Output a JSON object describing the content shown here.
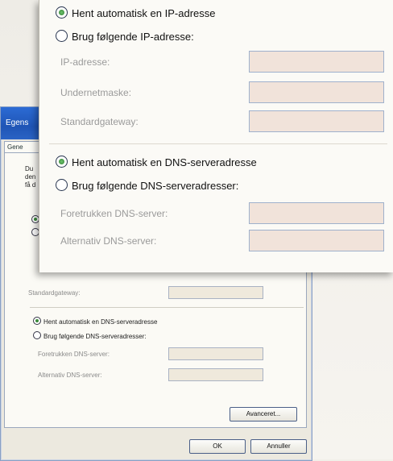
{
  "back_dialog": {
    "title": "Egens",
    "tab": "Gene",
    "intro": "Du den få d",
    "label_standard_gateway": "Standardgateway:",
    "radio_auto_dns": "Hent automatisk en DNS-serveradresse",
    "radio_manual_dns": "Brug følgende DNS-serveradresser:",
    "label_preferred_dns": "Foretrukken DNS-server:",
    "label_alternate_dns": "Alternativ DNS-server:",
    "advanced_button": "Avanceret...",
    "ok_button": "OK",
    "cancel_button": "Annuller"
  },
  "front_dialog": {
    "radio_auto_ip": "Hent automatisk en IP-adresse",
    "radio_manual_ip": "Brug følgende IP-adresse:",
    "label_ip": "IP-adresse:",
    "label_subnet": "Undernetmaske:",
    "label_gateway": "Standardgateway:",
    "radio_auto_dns": "Hent automatisk en DNS-serveradresse",
    "radio_manual_dns": "Brug følgende DNS-serveradresser:",
    "label_preferred_dns": "Foretrukken DNS-server:",
    "label_alternate_dns": "Alternativ DNS-server:"
  }
}
